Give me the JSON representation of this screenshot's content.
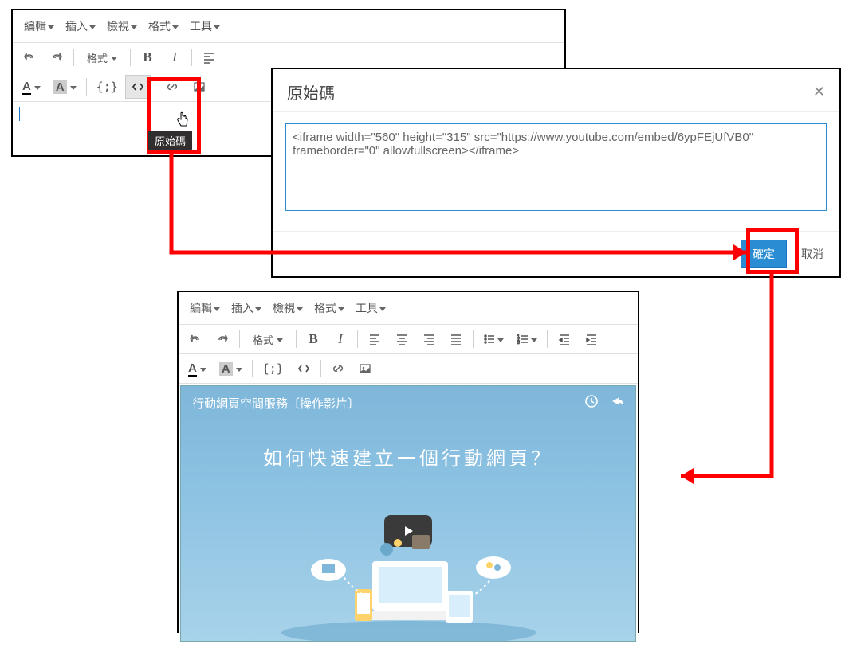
{
  "menus": {
    "edit": "編輯",
    "insert": "插入",
    "view": "檢視",
    "format": "格式",
    "tools": "工具"
  },
  "toolbar": {
    "format_label": "格式",
    "bold": "B",
    "italic": "I",
    "textcolor": "A",
    "bgcolor": "A",
    "template": "{;}"
  },
  "tooltip_source": "原始碼",
  "dialog": {
    "title": "原始碼",
    "content": "<iframe width=\"560\" height=\"315\" src=\"https://www.youtube.com/embed/6ypFEjUfVB0\" frameborder=\"0\" allowfullscreen></iframe>",
    "ok": "確定",
    "cancel": "取消"
  },
  "video": {
    "title": "行動網頁空間服務〔操作影片〕",
    "caption": "如何快速建立一個行動網頁？"
  }
}
